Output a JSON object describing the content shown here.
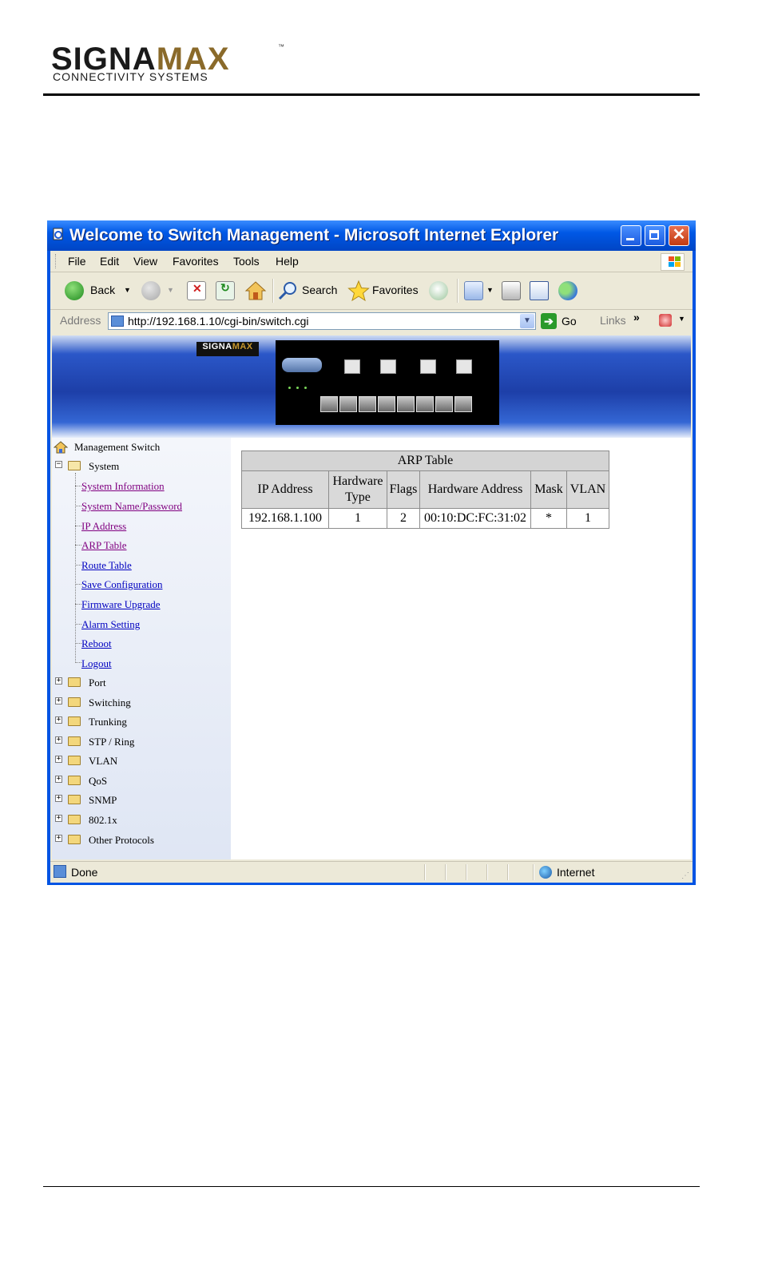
{
  "doc_logo": {
    "brand_left": "SIGNA",
    "brand_right": "MAX",
    "tm": "™",
    "tagline": "CONNECTIVITY SYSTEMS"
  },
  "window": {
    "title": "Welcome to Switch Management - Microsoft Internet Explorer",
    "menu": [
      "File",
      "Edit",
      "View",
      "Favorites",
      "Tools",
      "Help"
    ],
    "toolbar": {
      "back": "Back",
      "search": "Search",
      "favorites": "Favorites"
    },
    "address": {
      "label": "Address",
      "url": "http://192.168.1.10/cgi-bin/switch.cgi",
      "go": "Go",
      "links": "Links",
      "links_more": "»"
    },
    "status": {
      "text": "Done",
      "zone": "Internet"
    }
  },
  "banner": {
    "logo_left": "SIGNA",
    "logo_right": "MAX"
  },
  "tree": {
    "root": "Management Switch",
    "system": {
      "label": "System",
      "items": [
        "System Information",
        "System Name/Password",
        "IP Address",
        "ARP Table",
        "Route Table",
        "Save Configuration",
        "Firmware Upgrade",
        "Alarm Setting",
        "Reboot",
        "Logout"
      ]
    },
    "folders": [
      "Port",
      "Switching",
      "Trunking",
      "STP / Ring",
      "VLAN",
      "QoS",
      "SNMP",
      "802.1x",
      "Other Protocols"
    ]
  },
  "arp": {
    "title": "ARP Table",
    "headers": {
      "ip": "IP Address",
      "hw_type_1": "Hardware",
      "hw_type_2": "Type",
      "flags": "Flags",
      "hw_addr": "Hardware Address",
      "mask": "Mask",
      "vlan": "VLAN"
    },
    "rows": [
      {
        "ip": "192.168.1.100",
        "hw_type": "1",
        "flags": "2",
        "hw_addr": "00:10:DC:FC:31:02",
        "mask": "*",
        "vlan": "1"
      }
    ]
  }
}
